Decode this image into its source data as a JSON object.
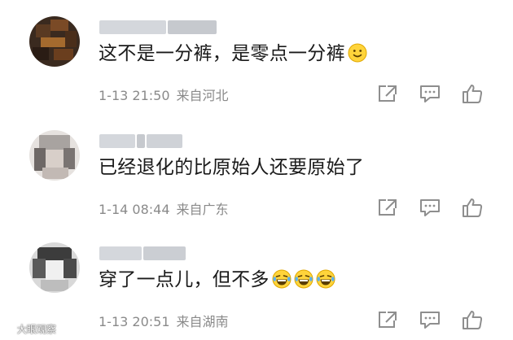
{
  "comments": [
    {
      "text": "这不是一分裤，是零点一分裤",
      "emojis": [
        "slightly-smiling-face"
      ],
      "date": "1-13 21:50",
      "location": "来自河北"
    },
    {
      "text": "已经退化的比原始人还要原始了",
      "emojis": [],
      "date": "1-14 08:44",
      "location": "来自广东"
    },
    {
      "text": "穿了一点儿，但不多",
      "emojis": [
        "laughing-tears-face",
        "laughing-tears-face",
        "laughing-tears-face"
      ],
      "date": "1-13 20:51",
      "location": "来自湖南"
    }
  ],
  "actions": [
    "share-icon",
    "comment-icon",
    "like-icon"
  ],
  "watermark": {
    "text": "大眼观察",
    "icon": "eye-icon"
  },
  "colors": {
    "text": "#1a1a1a",
    "meta": "#8a8a8a",
    "icon": "#8e8e8e"
  }
}
